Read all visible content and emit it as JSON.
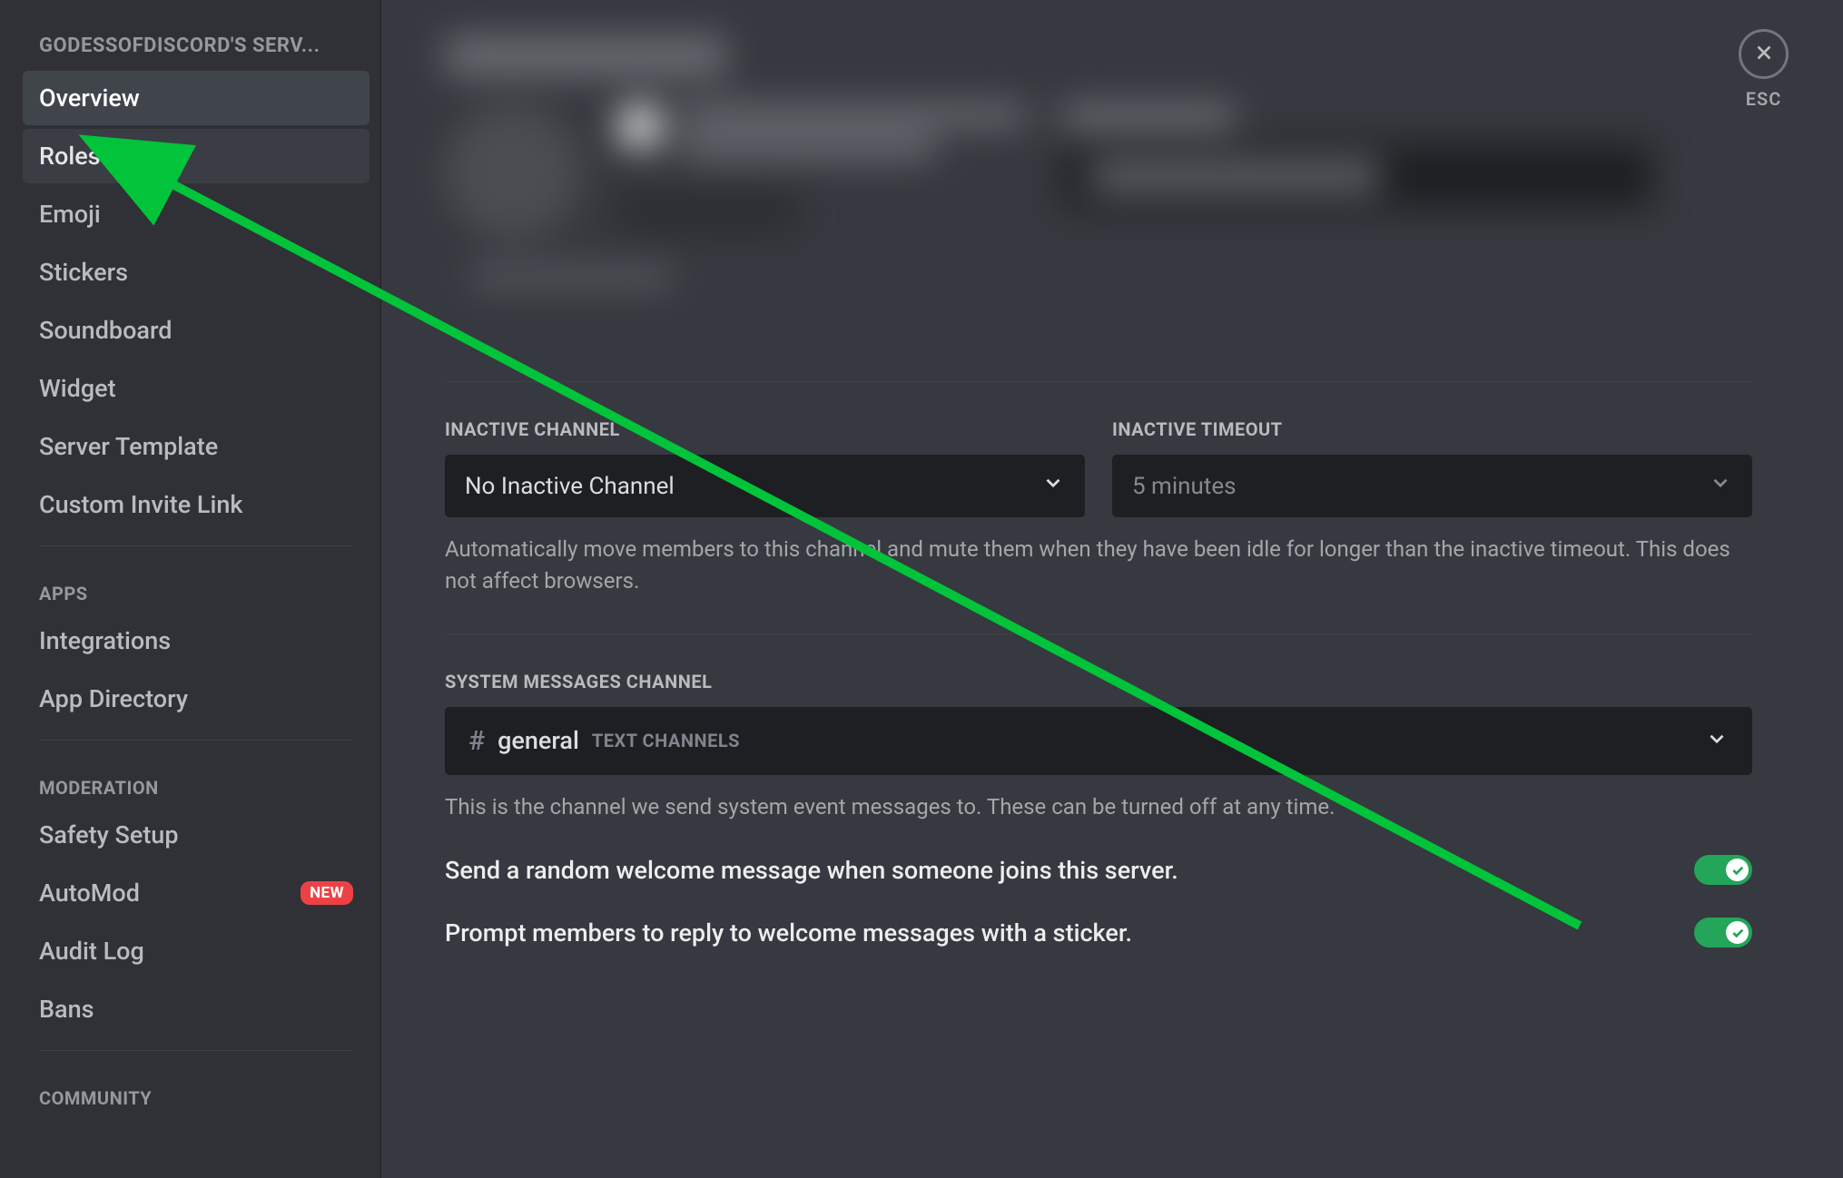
{
  "sidebar": {
    "server_name": "GODESSOFDISCORD'S SERV...",
    "items_main": [
      {
        "label": "Overview",
        "selected": true
      },
      {
        "label": "Roles",
        "hovered": true
      },
      {
        "label": "Emoji"
      },
      {
        "label": "Stickers"
      },
      {
        "label": "Soundboard"
      },
      {
        "label": "Widget"
      },
      {
        "label": "Server Template"
      },
      {
        "label": "Custom Invite Link"
      }
    ],
    "section_apps": "APPS",
    "items_apps": [
      {
        "label": "Integrations"
      },
      {
        "label": "App Directory"
      }
    ],
    "section_moderation": "MODERATION",
    "items_moderation": [
      {
        "label": "Safety Setup"
      },
      {
        "label": "AutoMod",
        "badge": "NEW"
      },
      {
        "label": "Audit Log"
      },
      {
        "label": "Bans"
      }
    ],
    "section_community": "COMMUNITY"
  },
  "close": {
    "esc": "ESC"
  },
  "inactive": {
    "channel_label": "INACTIVE CHANNEL",
    "channel_value": "No Inactive Channel",
    "timeout_label": "INACTIVE TIMEOUT",
    "timeout_value": "5 minutes",
    "help": "Automatically move members to this channel and mute them when they have been idle for longer than the inactive timeout. This does not affect browsers."
  },
  "system": {
    "label": "SYSTEM MESSAGES CHANNEL",
    "hash": "#",
    "channel_name": "general",
    "category": "TEXT CHANNELS",
    "help": "This is the channel we send system event messages to. These can be turned off at any time.",
    "toggle1": "Send a random welcome message when someone joins this server.",
    "toggle2": "Prompt members to reply to welcome messages with a sticker."
  },
  "colors": {
    "accent_green": "#23a55a",
    "arrow_green": "#02c43a",
    "badge_red": "#ed4245"
  }
}
